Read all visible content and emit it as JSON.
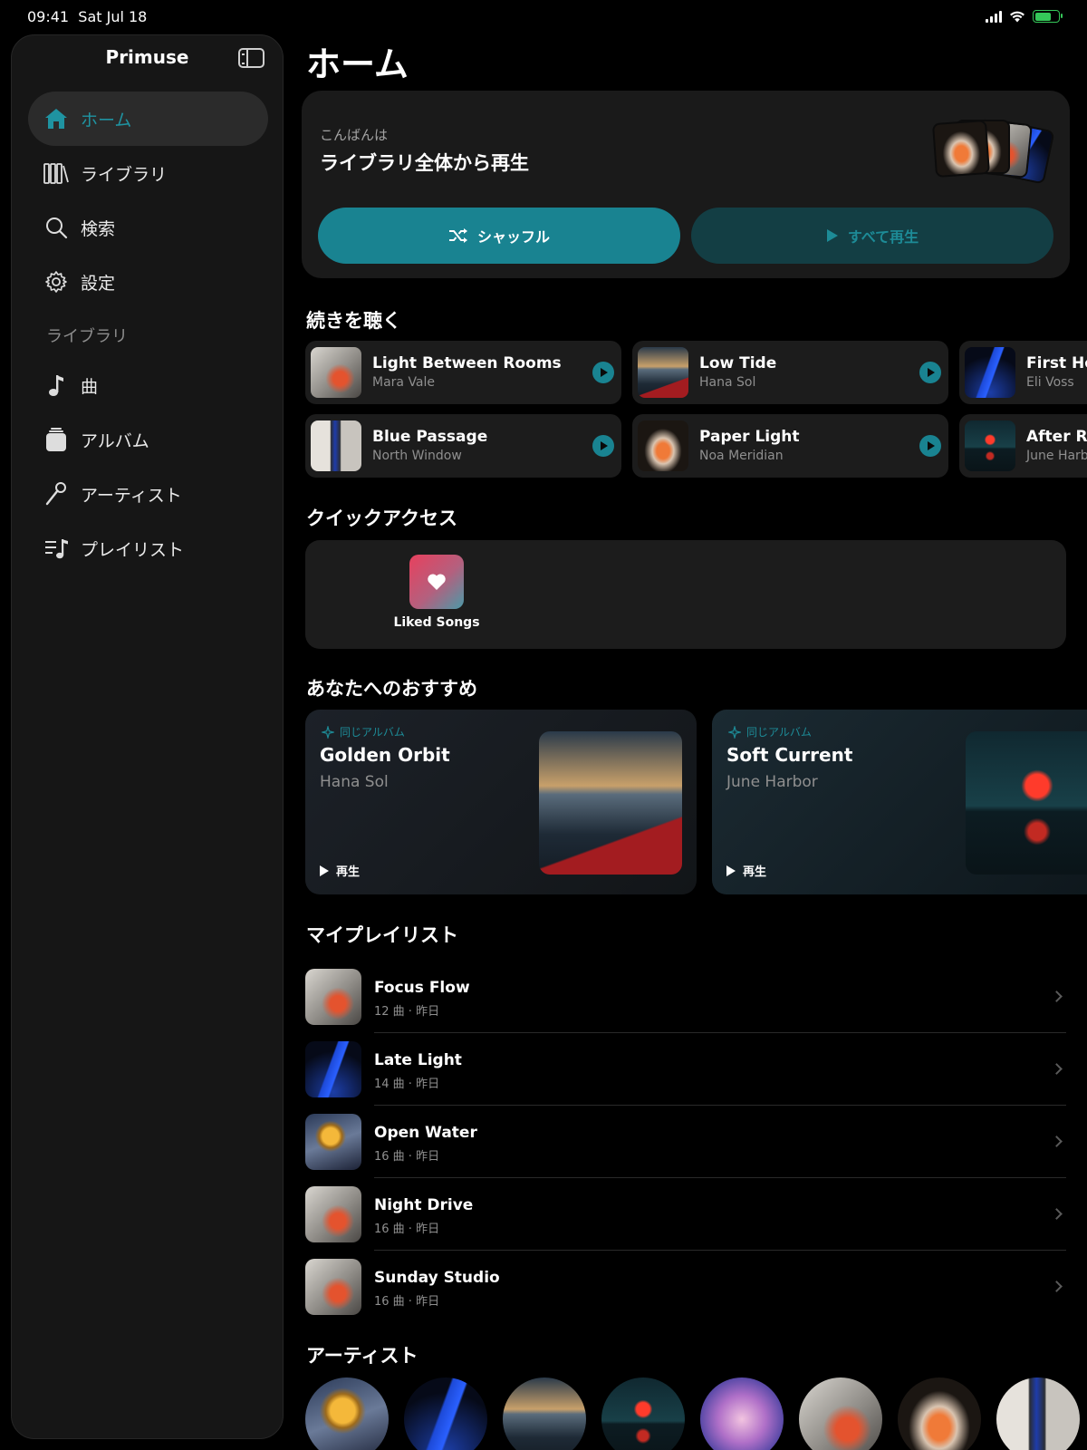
{
  "status": {
    "time": "09:41",
    "date": "Sat Jul 18"
  },
  "sidebar": {
    "app_name": "Primuse",
    "nav": [
      {
        "label": "ホーム",
        "icon": "home-icon"
      },
      {
        "label": "ライブラリ",
        "icon": "library-icon"
      },
      {
        "label": "検索",
        "icon": "search-icon"
      },
      {
        "label": "設定",
        "icon": "gear-icon"
      }
    ],
    "section_label": "ライブラリ",
    "library": [
      {
        "label": "曲",
        "icon": "music-note-icon"
      },
      {
        "label": "アルバム",
        "icon": "album-stack-icon"
      },
      {
        "label": "アーティスト",
        "icon": "microphone-icon"
      },
      {
        "label": "プレイリスト",
        "icon": "playlist-icon"
      }
    ]
  },
  "main": {
    "title": "ホーム",
    "hero": {
      "greeting": "こんばんは",
      "title": "ライブラリ全体から再生",
      "shuffle_label": "シャッフル",
      "play_all_label": "すべて再生"
    },
    "continue_title": "続きを聴く",
    "continue_items": [
      {
        "title": "Light Between Rooms",
        "artist": "Mara Vale"
      },
      {
        "title": "Low Tide",
        "artist": "Hana Sol"
      },
      {
        "title": "First Hor",
        "artist": "Eli Voss"
      },
      {
        "title": "Blue Passage",
        "artist": "North Window"
      },
      {
        "title": "Paper Light",
        "artist": "Noa Meridian"
      },
      {
        "title": "After Ra",
        "artist": "June Harb"
      }
    ],
    "quick_title": "クイックアクセス",
    "quick_items": [
      {
        "label": "Liked Songs",
        "icon": "heart-icon"
      }
    ],
    "rec_title": "あなたへのおすすめ",
    "recommendations": [
      {
        "tag": "同じアルバム",
        "title": "Golden Orbit",
        "artist": "Hana Sol",
        "play_label": "再生"
      },
      {
        "tag": "同じアルバム",
        "title": "Soft Current",
        "artist": "June Harbor",
        "play_label": "再生"
      }
    ],
    "playlists_title": "マイプレイリスト",
    "playlists": [
      {
        "name": "Focus Flow",
        "meta": "12 曲 · 昨日"
      },
      {
        "name": "Late Light",
        "meta": "14 曲 · 昨日"
      },
      {
        "name": "Open Water",
        "meta": "16 曲 · 昨日"
      },
      {
        "name": "Night Drive",
        "meta": "16 曲 · 昨日"
      },
      {
        "name": "Sunday Studio",
        "meta": "16 曲 · 昨日"
      }
    ],
    "artists_title": "アーティスト"
  },
  "colors": {
    "accent": "#198391",
    "accent_dark": "#133e44",
    "background": "#000000",
    "card": "#1c1c1c"
  }
}
